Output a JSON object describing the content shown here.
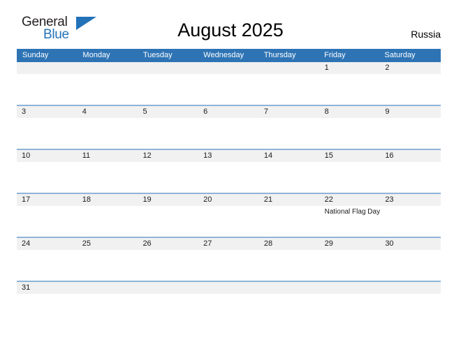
{
  "logo": {
    "word_one": "General",
    "word_two": "Blue",
    "triangle_icon": "blue-triangle-icon",
    "brand_color": "#2272b8"
  },
  "header": {
    "title": "August 2025",
    "country": "Russia"
  },
  "theme": {
    "header_blue": "#2e74b5",
    "separator_blue": "#8eb4d9",
    "day_band_gray": "#f1f1f1",
    "text_dark": "#1a1a1a"
  },
  "calendar": {
    "weekdays": [
      "Sunday",
      "Monday",
      "Tuesday",
      "Wednesday",
      "Thursday",
      "Friday",
      "Saturday"
    ],
    "weeks": [
      [
        {
          "date": "",
          "event": ""
        },
        {
          "date": "",
          "event": ""
        },
        {
          "date": "",
          "event": ""
        },
        {
          "date": "",
          "event": ""
        },
        {
          "date": "",
          "event": ""
        },
        {
          "date": "1",
          "event": ""
        },
        {
          "date": "2",
          "event": ""
        }
      ],
      [
        {
          "date": "3",
          "event": ""
        },
        {
          "date": "4",
          "event": ""
        },
        {
          "date": "5",
          "event": ""
        },
        {
          "date": "6",
          "event": ""
        },
        {
          "date": "7",
          "event": ""
        },
        {
          "date": "8",
          "event": ""
        },
        {
          "date": "9",
          "event": ""
        }
      ],
      [
        {
          "date": "10",
          "event": ""
        },
        {
          "date": "11",
          "event": ""
        },
        {
          "date": "12",
          "event": ""
        },
        {
          "date": "13",
          "event": ""
        },
        {
          "date": "14",
          "event": ""
        },
        {
          "date": "15",
          "event": ""
        },
        {
          "date": "16",
          "event": ""
        }
      ],
      [
        {
          "date": "17",
          "event": ""
        },
        {
          "date": "18",
          "event": ""
        },
        {
          "date": "19",
          "event": ""
        },
        {
          "date": "20",
          "event": ""
        },
        {
          "date": "21",
          "event": ""
        },
        {
          "date": "22",
          "event": "National Flag Day"
        },
        {
          "date": "23",
          "event": ""
        }
      ],
      [
        {
          "date": "24",
          "event": ""
        },
        {
          "date": "25",
          "event": ""
        },
        {
          "date": "26",
          "event": ""
        },
        {
          "date": "27",
          "event": ""
        },
        {
          "date": "28",
          "event": ""
        },
        {
          "date": "29",
          "event": ""
        },
        {
          "date": "30",
          "event": ""
        }
      ],
      [
        {
          "date": "31",
          "event": ""
        },
        {
          "date": "",
          "event": ""
        },
        {
          "date": "",
          "event": ""
        },
        {
          "date": "",
          "event": ""
        },
        {
          "date": "",
          "event": ""
        },
        {
          "date": "",
          "event": ""
        },
        {
          "date": "",
          "event": ""
        }
      ]
    ]
  }
}
